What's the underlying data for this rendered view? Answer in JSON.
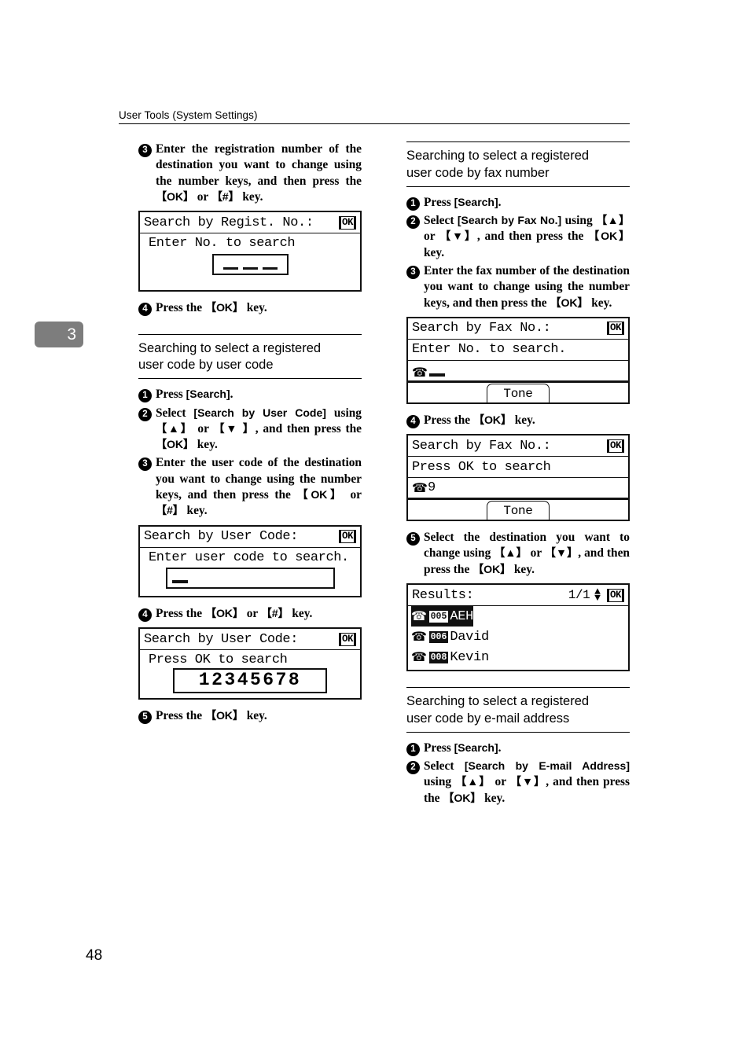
{
  "header": {
    "running_head": "User Tools (System Settings)"
  },
  "chapter_tab": {
    "number": "3"
  },
  "page_number": "48",
  "left_column": {
    "step3": {
      "num": "3",
      "text_part1": "Enter the registration number of the destination you want to change using the number keys, and then press the ",
      "key_ok": "【OK】",
      "text_or": " or ",
      "key_hash": "【#】",
      "text_end": " key."
    },
    "lcd_regist": {
      "title": "Search by Regist. No.:",
      "ok_label": "OK",
      "prompt": "Enter No. to search",
      "field_dashes": 3
    },
    "step4": {
      "num": "4",
      "text_start": "Press the ",
      "key_ok": "【OK】",
      "text_end": " key."
    },
    "section_user_code": {
      "title_line1": "Searching to select a registered",
      "title_line2": "user code by user code"
    },
    "uc_step1": {
      "num": "1",
      "text_start": "Press ",
      "ui_key": "[Search]",
      "text_end": "."
    },
    "uc_step2": {
      "num": "2",
      "text_start": "Select ",
      "ui_key": "[Search by User Code]",
      "text_mid": " using ",
      "key_up": "【▲】",
      "text_or": " or ",
      "key_down": "【▼ 】",
      "text_mid2": ", and then press the ",
      "key_ok": "【OK】",
      "text_end": " key."
    },
    "uc_step3": {
      "num": "3",
      "text_start": "Enter the user code of the destination you want to change using the number keys, and then press the ",
      "key_ok": "【OK】",
      "text_or": " or ",
      "key_hash": "【#】",
      "text_end": " key."
    },
    "lcd_usercode_entry": {
      "title": "Search by User Code:",
      "ok_label": "OK",
      "prompt": "Enter user code to search.",
      "field_cursor": "_"
    },
    "uc_step4": {
      "num": "4",
      "text_start": "Press the ",
      "key_ok": "【OK】",
      "text_or": " or ",
      "key_hash": "【#】",
      "text_end": " key."
    },
    "lcd_usercode_result": {
      "title": "Search by User Code:",
      "ok_label": "OK",
      "prompt": "Press OK to search",
      "value": "12345678"
    },
    "uc_step5": {
      "num": "5",
      "text_start": "Press the ",
      "key_ok": "【OK】",
      "text_end": " key."
    }
  },
  "right_column": {
    "section_fax": {
      "title_line1": "Searching to select a registered",
      "title_line2": "user code by fax number"
    },
    "fax_step1": {
      "num": "1",
      "text_start": "Press ",
      "ui_key": "[Search]",
      "text_end": "."
    },
    "fax_step2": {
      "num": "2",
      "text_start": "Select ",
      "ui_key": "[Search by Fax No.]",
      "text_mid": " using ",
      "key_up": "【▲】",
      "text_or": " or ",
      "key_down": "【▼】",
      "text_mid2": ", and then press the ",
      "key_ok": "【OK】",
      "text_end": " key."
    },
    "fax_step3": {
      "num": "3",
      "text_start": "Enter the fax number of the destination you want to change using the number keys, and then press the ",
      "key_ok": "【OK】",
      "text_end": " key."
    },
    "lcd_fax_entry": {
      "title": "Search by Fax No.:",
      "ok_label": "OK",
      "prompt": "Enter No. to search.",
      "phone_icon": "phone-icon",
      "value": "_",
      "softkey": "Tone"
    },
    "fax_step4": {
      "num": "4",
      "text_start": "Press the ",
      "key_ok": "【OK】",
      "text_end": " key."
    },
    "lcd_fax_result": {
      "title": "Search by Fax No.:",
      "ok_label": "OK",
      "prompt": "Press OK to search",
      "phone_icon": "phone-icon",
      "value": "9",
      "softkey": "Tone"
    },
    "fax_step5": {
      "num": "5",
      "text_start": "Select the destination you want to change using ",
      "key_up": "【▲】",
      "text_or": " or ",
      "key_down": "【▼】",
      "text_mid": ", and then press the ",
      "key_ok": "【OK】",
      "text_end": " key."
    },
    "lcd_results": {
      "title": "Results:",
      "page_indicator": "1/1",
      "ok_label": "OK",
      "rows": [
        {
          "code": "005",
          "name": "AEH",
          "selected": true
        },
        {
          "code": "006",
          "name": "David",
          "selected": false
        },
        {
          "code": "008",
          "name": "Kevin",
          "selected": false
        }
      ]
    },
    "section_email": {
      "title_line1": "Searching to select a registered",
      "title_line2": "user code by e-mail address"
    },
    "em_step1": {
      "num": "1",
      "text_start": "Press ",
      "ui_key": "[Search]",
      "text_end": "."
    },
    "em_step2": {
      "num": "2",
      "text_start": "Select ",
      "ui_key": "[Search by E-mail Address]",
      "text_mid": " using ",
      "key_up": "【▲】",
      "text_or": " or ",
      "key_down": "【▼】",
      "text_mid2": ", and then press the ",
      "key_ok": "【OK】",
      "text_end": " key."
    }
  }
}
